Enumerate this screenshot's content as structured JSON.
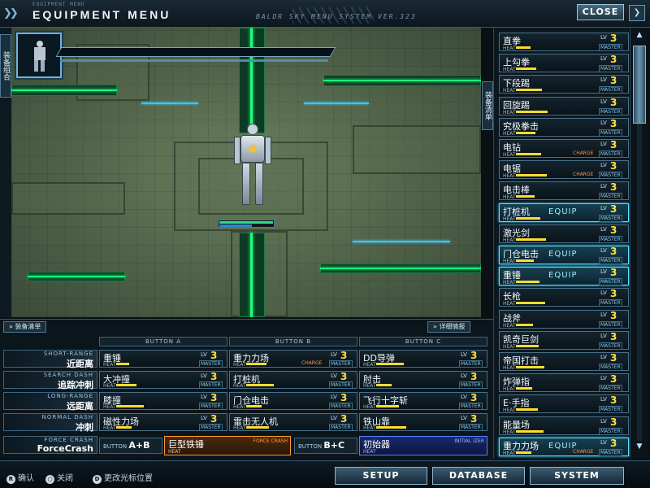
{
  "header": {
    "small_text": "EQUIPMENT MENU",
    "title": "EQUIPMENT MENU",
    "subtitle": "BALDR SKY MENU SYSTEM VER.323",
    "close_label": "CLOSE"
  },
  "side_tabs": {
    "left": "装备组合",
    "right": "装备清单"
  },
  "right_list": [
    {
      "name": "直拳",
      "level": "3",
      "equip": ""
    },
    {
      "name": "上勾拳",
      "level": "3",
      "equip": ""
    },
    {
      "name": "下段踢",
      "level": "3",
      "equip": ""
    },
    {
      "name": "回旋踢",
      "level": "3",
      "equip": ""
    },
    {
      "name": "究极拳击",
      "level": "3",
      "equip": ""
    },
    {
      "name": "电钻",
      "level": "3",
      "equip": "",
      "charge": "CHARGE"
    },
    {
      "name": "电锯",
      "level": "3",
      "equip": "",
      "charge": "CHARGE"
    },
    {
      "name": "电击棒",
      "level": "3",
      "equip": ""
    },
    {
      "name": "打桩机",
      "level": "3",
      "equip": "EQUIP"
    },
    {
      "name": "激光剑",
      "level": "3",
      "equip": ""
    },
    {
      "name": "门仓电击",
      "level": "3",
      "equip": "EQUIP"
    },
    {
      "name": "重锤",
      "level": "3",
      "equip": "EQUIP"
    },
    {
      "name": "长枪",
      "level": "3",
      "equip": ""
    },
    {
      "name": "战斧",
      "level": "3",
      "equip": ""
    },
    {
      "name": "凯奇巨剑",
      "level": "3",
      "equip": ""
    },
    {
      "name": "帝国打击",
      "level": "3",
      "equip": ""
    },
    {
      "name": "炸弹指",
      "level": "3",
      "equip": ""
    },
    {
      "name": "E·手指",
      "level": "3",
      "equip": ""
    },
    {
      "name": "能量场",
      "level": "3",
      "equip": ""
    },
    {
      "name": "重力力场",
      "level": "3",
      "equip": "EQUIP",
      "charge": "CHARGE"
    }
  ],
  "labels": {
    "lv": "LV",
    "master": "MASTER",
    "heat": "HEAT",
    "charge": "CHARGE"
  },
  "bottom": {
    "tab_left": "装备清单",
    "tab_right": "详细情报",
    "columns": [
      "BUTTON A",
      "BUTTON B",
      "BUTTON C"
    ],
    "rows": [
      {
        "en": "SHORT-RANGE",
        "zh": "近距离",
        "slots": [
          {
            "name": "重锤",
            "level": "3"
          },
          {
            "name": "重力力场",
            "level": "3",
            "charge": "CHARGE"
          },
          {
            "name": "DD导弹",
            "level": "3"
          }
        ]
      },
      {
        "en": "SEARCH DASH",
        "zh": "追踪冲刺",
        "slots": [
          {
            "name": "大冲撞",
            "level": "3"
          },
          {
            "name": "打桩机",
            "level": "3"
          },
          {
            "name": "肘击",
            "level": "3"
          }
        ]
      },
      {
        "en": "LONG-RANGE",
        "zh": "远距离",
        "slots": [
          {
            "name": "膝撞",
            "level": "3"
          },
          {
            "name": "门仓电击",
            "level": "3"
          },
          {
            "name": "飞行十字斩",
            "level": "3"
          }
        ]
      },
      {
        "en": "NORMAL DASH",
        "zh": "冲刺",
        "slots": [
          {
            "name": "磁性力场",
            "level": "3"
          },
          {
            "name": "雷击无人机",
            "level": "3"
          },
          {
            "name": "铁山靠",
            "level": "3"
          }
        ]
      }
    ],
    "force_crash": {
      "en": "FORCE CRASH",
      "zh": "ForceCrash",
      "button_ab": "A+B",
      "button_bc": "B+C",
      "button_word": "BUTTON",
      "slot_ab": "巨型铁锤",
      "slot_ab_tag": "FORCE CRASH",
      "slot_bc": "初始器",
      "slot_bc_tag": "INITIAL IZER"
    }
  },
  "footer": {
    "hint_confirm": "确认",
    "hint_close": "关闭",
    "hint_move": "更改光标位置",
    "buttons": [
      "SETUP",
      "DATABASE",
      "SYSTEM"
    ]
  }
}
